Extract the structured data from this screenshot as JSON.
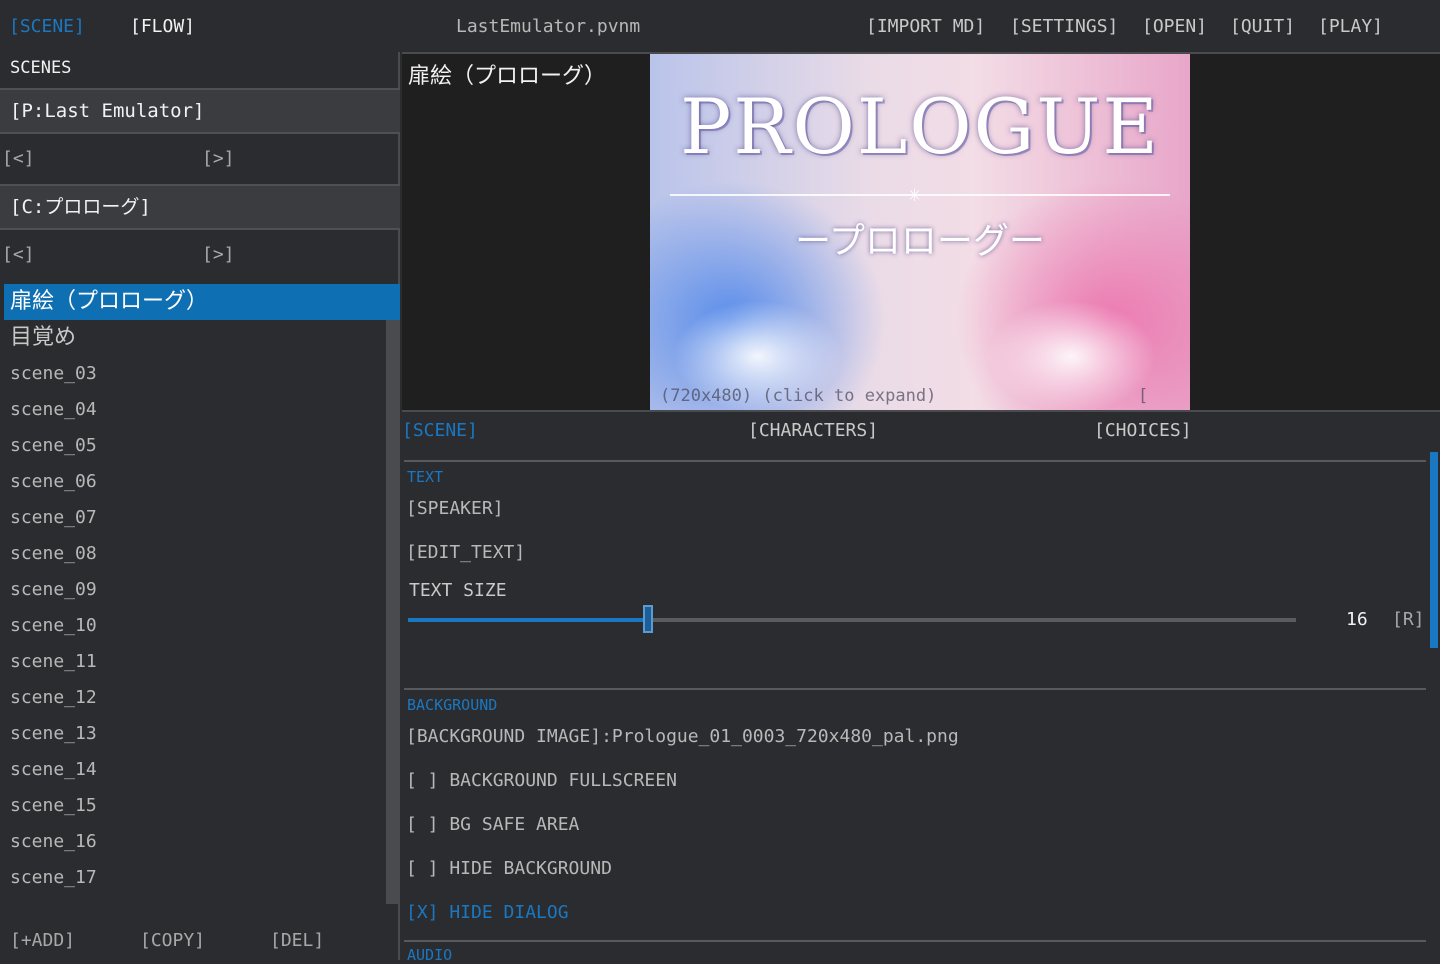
{
  "topbar": {
    "scene_tab": "[SCENE]",
    "flow_tab": "[FLOW]",
    "file_title": "LastEmulator.pvnm",
    "import_md": "[IMPORT MD]",
    "settings": "[SETTINGS]",
    "open": "[OPEN]",
    "quit": "[QUIT]",
    "play": "[PLAY]"
  },
  "left": {
    "header": "SCENES",
    "project_selector": "[P:Last Emulator]",
    "chapter_selector": "[C:プロローグ]",
    "prev": "[<]",
    "next": "[>]",
    "scenes": [
      "扉絵（プロローグ）",
      "目覚め",
      "scene_03",
      "scene_04",
      "scene_05",
      "scene_06",
      "scene_07",
      "scene_08",
      "scene_09",
      "scene_10",
      "scene_11",
      "scene_12",
      "scene_13",
      "scene_14",
      "scene_15",
      "scene_16",
      "scene_17"
    ],
    "selected_index": 0,
    "add": "[+ADD]",
    "copy": "[COPY]",
    "del": "[DEL]"
  },
  "preview": {
    "scene_title": "扉絵（プロローグ）",
    "image_title": "PROLOGUE",
    "image_subtitle": "ープロローグー",
    "caption": "(720x480) (click to expand)",
    "caption_right": "["
  },
  "inspector": {
    "tabs": {
      "scene": "[SCENE]",
      "characters": "[CHARACTERS]",
      "choices": "[CHOICES]"
    },
    "text_section": "TEXT",
    "speaker": "[SPEAKER]",
    "edit_text": "[EDIT_TEXT]",
    "text_size_label": "TEXT SIZE",
    "text_size_value": "16",
    "text_size_fraction": 0.27,
    "reset": "[R]",
    "background_section": "BACKGROUND",
    "background_image": "[BACKGROUND IMAGE]:Prologue_01_0003_720x480_pal.png",
    "bg_fullscreen": "[ ] BACKGROUND FULLSCREEN",
    "bg_safe_area": "[ ] BG SAFE AREA",
    "hide_background": "[ ] HIDE BACKGROUND",
    "hide_dialog": "[X] HIDE DIALOG",
    "audio_section": "AUDIO"
  },
  "colors": {
    "accent": "#1a78c2",
    "selected_bg": "#0f6fb3",
    "panel_bg": "#2b2c2f",
    "preview_bg": "#1f1f20"
  }
}
